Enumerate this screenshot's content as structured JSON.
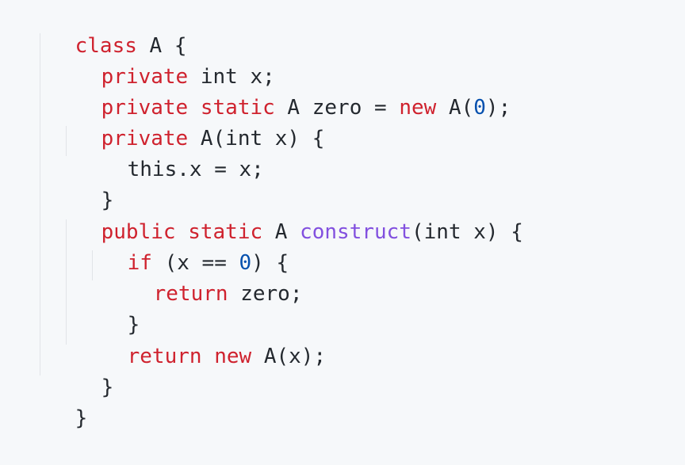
{
  "code": {
    "colors": {
      "background": "#f6f8fa",
      "keyword": "#cf222e",
      "function": "#8250df",
      "number": "#0550ae",
      "text": "#24292f"
    },
    "lines": [
      {
        "tokens": [
          {
            "type": "kw",
            "text": "class"
          },
          {
            "type": "plain",
            "text": " A {"
          }
        ]
      },
      {
        "tokens": [
          {
            "type": "kw",
            "text": "private"
          },
          {
            "type": "plain",
            "text": " int x;"
          }
        ]
      },
      {
        "tokens": [
          {
            "type": "kw",
            "text": "private"
          },
          {
            "type": "plain",
            "text": " "
          },
          {
            "type": "kw",
            "text": "static"
          },
          {
            "type": "plain",
            "text": " A zero = "
          },
          {
            "type": "kw",
            "text": "new"
          },
          {
            "type": "plain",
            "text": " A("
          },
          {
            "type": "num",
            "text": "0"
          },
          {
            "type": "plain",
            "text": ");"
          }
        ]
      },
      {
        "tokens": [
          {
            "type": "kw",
            "text": "private"
          },
          {
            "type": "plain",
            "text": " A(int x) {"
          }
        ]
      },
      {
        "tokens": [
          {
            "type": "plain",
            "text": "this.x = x;"
          }
        ]
      },
      {
        "tokens": [
          {
            "type": "plain",
            "text": "}"
          }
        ]
      },
      {
        "tokens": [
          {
            "type": "kw",
            "text": "public"
          },
          {
            "type": "plain",
            "text": " "
          },
          {
            "type": "kw",
            "text": "static"
          },
          {
            "type": "plain",
            "text": " A "
          },
          {
            "type": "fn",
            "text": "construct"
          },
          {
            "type": "plain",
            "text": "(int x) {"
          }
        ]
      },
      {
        "tokens": [
          {
            "type": "kw",
            "text": "if"
          },
          {
            "type": "plain",
            "text": " (x == "
          },
          {
            "type": "num",
            "text": "0"
          },
          {
            "type": "plain",
            "text": ") {"
          }
        ]
      },
      {
        "tokens": [
          {
            "type": "kw",
            "text": "return"
          },
          {
            "type": "plain",
            "text": " zero;"
          }
        ]
      },
      {
        "tokens": [
          {
            "type": "plain",
            "text": "}"
          }
        ]
      },
      {
        "tokens": [
          {
            "type": "kw",
            "text": "return"
          },
          {
            "type": "plain",
            "text": " "
          },
          {
            "type": "kw",
            "text": "new"
          },
          {
            "type": "plain",
            "text": " A(x);"
          }
        ]
      },
      {
        "tokens": [
          {
            "type": "plain",
            "text": "}"
          }
        ]
      },
      {
        "tokens": [
          {
            "type": "plain",
            "text": "}"
          }
        ]
      }
    ]
  }
}
